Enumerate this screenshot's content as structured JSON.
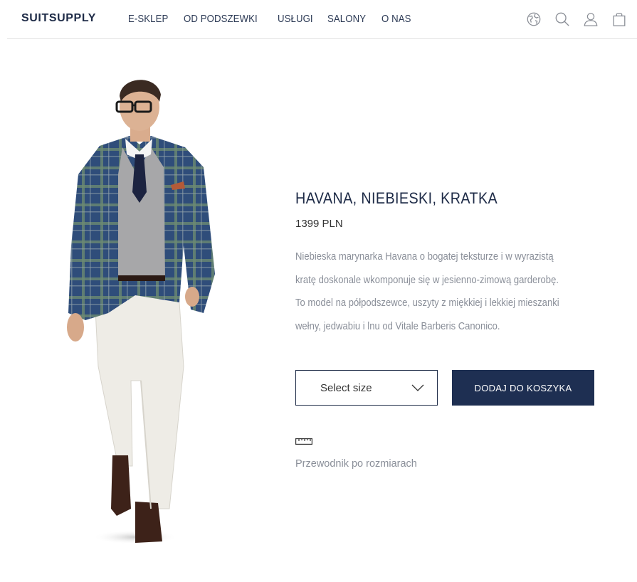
{
  "header": {
    "logo": "SUITSUPPLY",
    "nav": [
      "E-SKLEP",
      "OD PODSZEWKI",
      "USŁUGI",
      "SALONY",
      "O NAS"
    ],
    "icons": [
      "globe-icon",
      "search-icon",
      "user-icon",
      "shopping-bag-icon"
    ]
  },
  "product": {
    "title": "HAVANA, NIEBIESKI, KRATKA",
    "price": "1399 PLN",
    "description_lines": [
      "Niebieska marynarka Havana o bogatej teksturze i w wyrazistą",
      "kratę doskonale wkomponuje się w jesienno-zimową garderobę.",
      "To model na półpodszewce, uszyty z miękkiej i lekkiej mieszanki",
      "wełny, jedwabiu i lnu od Vitale Barberis Canonico."
    ],
    "size_select": {
      "selected": "Select size"
    },
    "add_to_cart": "DODAJ DO KOSZYKA",
    "size_guide": "Przewodnik po rozmiarach"
  },
  "colors": {
    "brand": "#1e2b47",
    "button": "#1e2f52",
    "muted_text": "#8a8f99"
  }
}
